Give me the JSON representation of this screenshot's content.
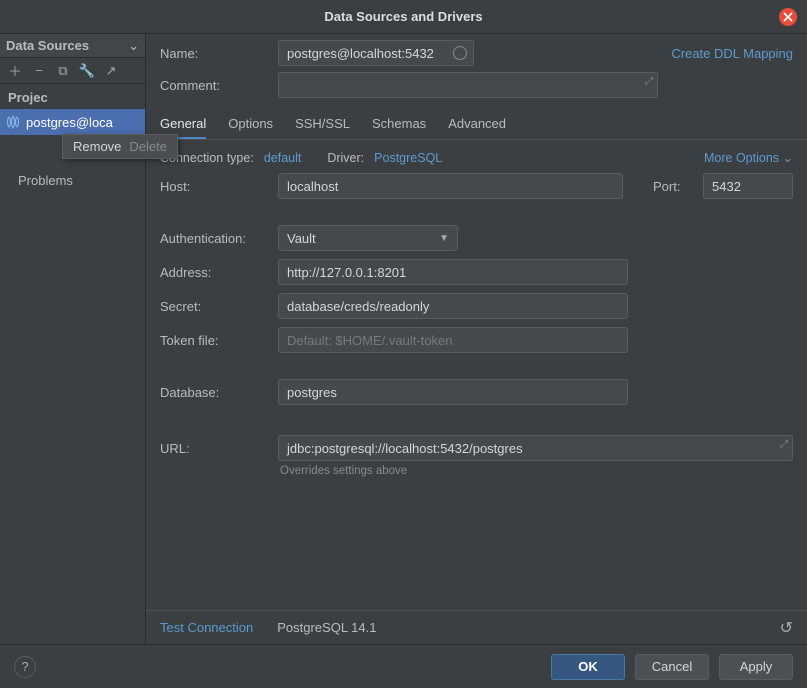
{
  "title": "Data Sources and Drivers",
  "sidebar": {
    "header": "Data Sources",
    "section_project_label": "Projec",
    "ds_item_label": "postgres@loca",
    "problems_label": "Problems",
    "tooltip_action": "Remove",
    "tooltip_key": "Delete"
  },
  "top": {
    "name_label": "Name:",
    "name_value": "postgres@localhost:5432",
    "ddl_link": "Create DDL Mapping",
    "comment_label": "Comment:"
  },
  "tabs": [
    "General",
    "Options",
    "SSH/SSL",
    "Schemas",
    "Advanced"
  ],
  "subrow": {
    "conn_type_label": "Connection type:",
    "conn_type_value": "default",
    "driver_label": "Driver:",
    "driver_value": "PostgreSQL",
    "more_options": "More Options"
  },
  "fields": {
    "host_label": "Host:",
    "host_value": "localhost",
    "port_label": "Port:",
    "port_value": "5432",
    "auth_label": "Authentication:",
    "auth_value": "Vault",
    "address_label": "Address:",
    "address_value": "http://127.0.0.1:8201",
    "secret_label": "Secret:",
    "secret_value": "database/creds/readonly",
    "token_label": "Token file:",
    "token_placeholder": "Default: $HOME/.vault-token",
    "database_label": "Database:",
    "database_value": "postgres",
    "url_label": "URL:",
    "url_value": "jdbc:postgresql://localhost:5432/postgres",
    "url_help": "Overrides settings above"
  },
  "status": {
    "test_connection": "Test Connection",
    "driver_version": "PostgreSQL 14.1"
  },
  "footer": {
    "ok": "OK",
    "cancel": "Cancel",
    "apply": "Apply"
  }
}
